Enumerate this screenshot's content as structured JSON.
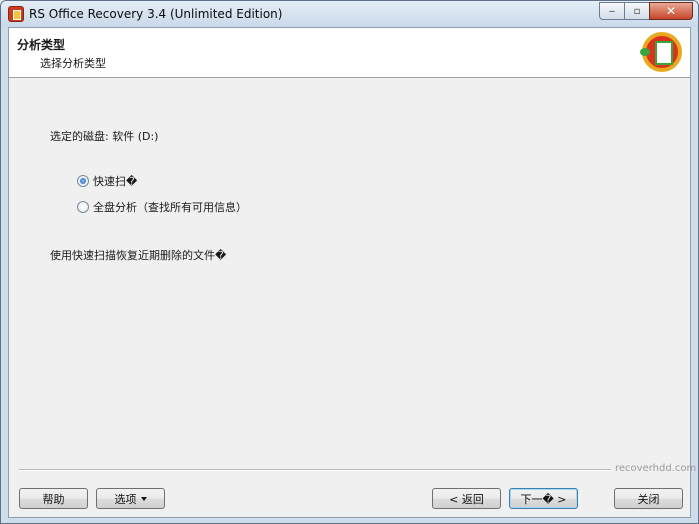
{
  "window": {
    "title": "RS Office Recovery 3.4 (Unlimited Edition)",
    "minimize_glyph": "‒",
    "maximize_glyph": "▫",
    "close_glyph": "✕"
  },
  "header": {
    "title": "分析类型",
    "subtitle": "选择分析类型",
    "logo_icon": "office-recovery-logo-icon"
  },
  "main": {
    "selected_disk": "选定的磁盘: 软件 (D:)",
    "options": [
      {
        "label": "快速扫�",
        "checked": true
      },
      {
        "label": "全盘分析（查找所有可用信息）",
        "checked": false
      }
    ],
    "hint": "使用快速扫描恢复近期删除的文件�"
  },
  "footer": {
    "watermark": "recoverhdd.com",
    "help_label": "帮助",
    "options_label": "选项",
    "back_label": "< 返回",
    "next_label": "下一� >",
    "close_label": "关闭"
  },
  "colors": {
    "title_bar": "#c9d8e9",
    "client_bg": "#f0f0f0",
    "header_bg": "#ffffff",
    "default_button_border": "#3c7fb1"
  }
}
